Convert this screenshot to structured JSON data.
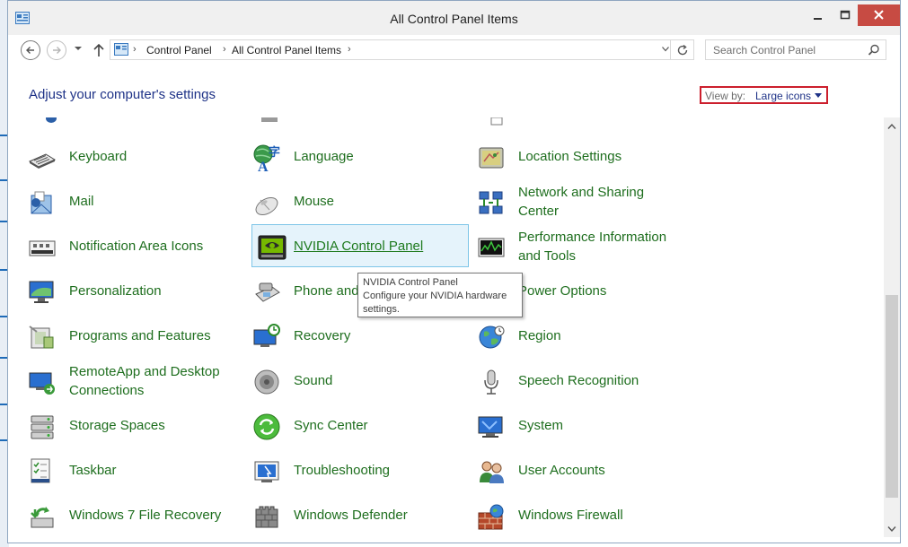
{
  "window": {
    "title": "All Control Panel Items"
  },
  "address_bar": {
    "crumbs": [
      "Control Panel",
      "All Control Panel Items"
    ]
  },
  "search": {
    "placeholder": "Search Control Panel"
  },
  "header": {
    "title": "Adjust your computer's settings",
    "view_by_label": "View by:",
    "view_by_value": "Large icons"
  },
  "items": [
    {
      "id": "keyboard",
      "label": "Keyboard",
      "icon": "keyboard-icon"
    },
    {
      "id": "language",
      "label": "Language",
      "icon": "language-icon"
    },
    {
      "id": "location-settings",
      "label": "Location Settings",
      "icon": "location-icon"
    },
    {
      "id": "mail",
      "label": "Mail",
      "icon": "mail-icon"
    },
    {
      "id": "mouse",
      "label": "Mouse",
      "icon": "mouse-icon"
    },
    {
      "id": "network-sharing",
      "label_line1": "Network and Sharing",
      "label_line2": "Center",
      "icon": "network-icon"
    },
    {
      "id": "notification-area",
      "label": "Notification Area Icons",
      "icon": "notification-icon"
    },
    {
      "id": "nvidia",
      "label": "NVIDIA Control Panel",
      "icon": "nvidia-icon"
    },
    {
      "id": "performance",
      "label_line1": "Performance Information",
      "label_line2": "and Tools",
      "icon": "performance-icon"
    },
    {
      "id": "personalization",
      "label": "Personalization",
      "icon": "personalization-icon"
    },
    {
      "id": "phone-modem",
      "label": "Phone and",
      "icon": "phone-icon"
    },
    {
      "id": "power-options",
      "label": "Power Options",
      "icon": "power-icon"
    },
    {
      "id": "programs-features",
      "label": "Programs and Features",
      "icon": "programs-icon"
    },
    {
      "id": "recovery",
      "label": "Recovery",
      "icon": "recovery-icon"
    },
    {
      "id": "region",
      "label": "Region",
      "icon": "globe-icon"
    },
    {
      "id": "remoteapp",
      "label_line1": "RemoteApp and Desktop",
      "label_line2": "Connections",
      "icon": "remoteapp-icon"
    },
    {
      "id": "sound",
      "label": "Sound",
      "icon": "speaker-icon"
    },
    {
      "id": "speech",
      "label": "Speech Recognition",
      "icon": "microphone-icon"
    },
    {
      "id": "storage-spaces",
      "label": "Storage Spaces",
      "icon": "storage-icon"
    },
    {
      "id": "sync-center",
      "label": "Sync Center",
      "icon": "sync-icon"
    },
    {
      "id": "system",
      "label": "System",
      "icon": "system-icon"
    },
    {
      "id": "taskbar",
      "label": "Taskbar",
      "icon": "taskbar-icon"
    },
    {
      "id": "troubleshooting",
      "label": "Troubleshooting",
      "icon": "troubleshoot-icon"
    },
    {
      "id": "user-accounts",
      "label": "User Accounts",
      "icon": "users-icon"
    },
    {
      "id": "win7-file-recovery",
      "label": "Windows 7 File Recovery",
      "icon": "file-recovery-icon"
    },
    {
      "id": "windows-defender",
      "label": "Windows Defender",
      "icon": "defender-icon"
    },
    {
      "id": "windows-firewall",
      "label": "Windows Firewall",
      "icon": "firewall-icon"
    }
  ],
  "tooltip": {
    "line1": "NVIDIA Control Panel",
    "line2": "Configure your NVIDIA hardware",
    "line3": "settings."
  },
  "colors": {
    "link_green": "#1e6e1e",
    "heading_blue": "#1e3287",
    "close_red": "#c74b43",
    "highlight_red": "#cc1f2d"
  }
}
